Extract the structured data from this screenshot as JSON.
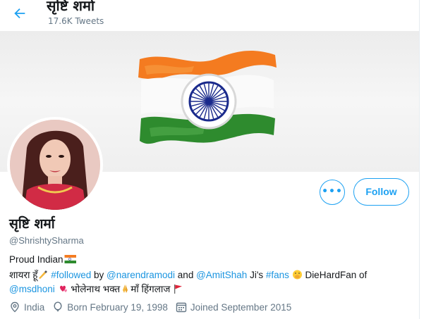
{
  "header": {
    "title": "सृष्टि शर्मा",
    "tweets_count": "17.6K Tweets"
  },
  "profile": {
    "name": "सृष्टि शर्मा",
    "handle": "@ShrishtySharma",
    "follow_label": "Follow",
    "more_label": "•••"
  },
  "bio": {
    "line1_text": "Proud Indian",
    "line2_part1": "शायरा हूँ",
    "line2_hashtag1": "#followed",
    "line2_by": " by ",
    "line2_mention1": "@narendramodi",
    "line2_and": " and ",
    "line2_mention2": "@AmitShah",
    "line2_jis": " Ji's ",
    "line2_hashtag2": "#fans",
    "line2_diehard": " DieHardFan of",
    "line3_mention": "@msdhoni",
    "line3_bhola": " भोलेनाथ भक्त",
    "line3_maa": "माँ हिंगलाज "
  },
  "meta": {
    "location": "India",
    "born": "Born February 19, 1998",
    "joined": "Joined September 2015"
  },
  "colors": {
    "accent": "#1da1f2",
    "link": "#1b95e0",
    "secondary_text": "#657786",
    "saffron": "#f47b20",
    "green": "#2e8b2e",
    "chakra": "#1a2a8c"
  },
  "icons": [
    "back-arrow-icon",
    "more-dots-icon",
    "location-pin-icon",
    "balloon-icon",
    "calendar-icon",
    "india-flag-emoji",
    "writing-hand-emoji",
    "hand-over-mouth-emoji",
    "two-hearts-emoji",
    "folded-hands-emoji",
    "red-flag-emoji"
  ]
}
